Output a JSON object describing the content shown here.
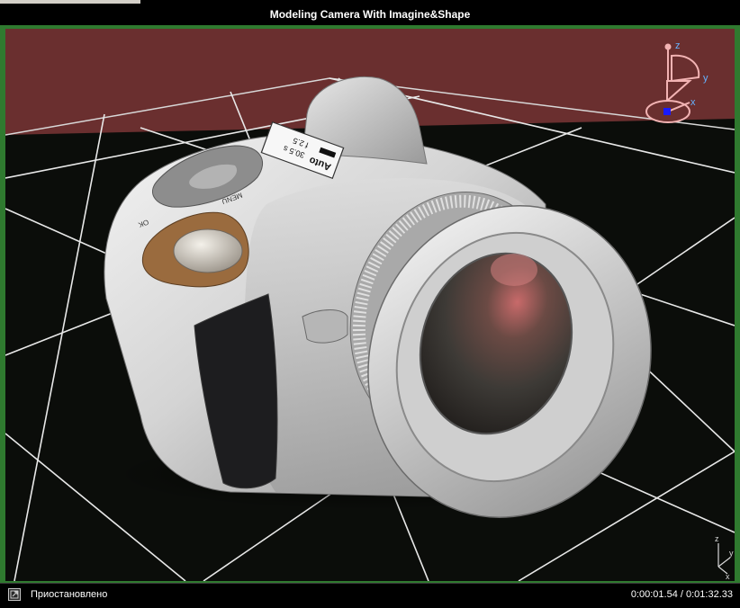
{
  "window": {
    "title": "Modeling Camera With Imagine&Shape"
  },
  "camera_label": {
    "mode": "Auto",
    "line1": "30.5 s",
    "line2": "f 2.5"
  },
  "camera_buttons": {
    "menu": "MENU",
    "ok": "OK"
  },
  "gizmo": {
    "z": "z",
    "y": "y",
    "x": "x"
  },
  "mini_axes": {
    "z": "z",
    "y": "y",
    "x": "x"
  },
  "status": {
    "button_icon": "maximize-icon",
    "text": "Приостановлено",
    "time": "0:00:01.54 / 0:01:32.33"
  },
  "colors": {
    "wall": "#6a2f2f",
    "floor": "#0b0d0a",
    "grid": "#e8e8e8",
    "frame": "#2f7a2f"
  }
}
